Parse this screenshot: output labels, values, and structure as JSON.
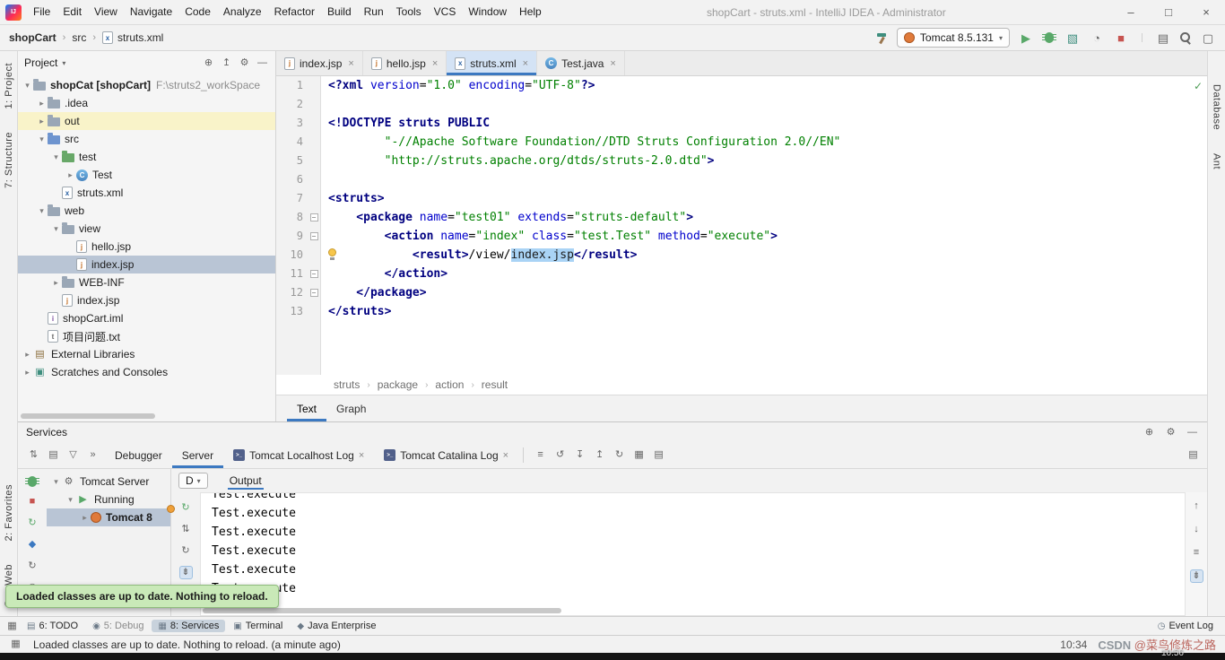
{
  "icons": {
    "minimize": "–",
    "maximize": "□",
    "close": "×",
    "chevron": "›",
    "dropdown": "▾",
    "expanded": "▾",
    "collapsed": "▸",
    "fold": "−",
    "locate": "⊕",
    "collapse_all": "↥",
    "settings": "⚙",
    "hide": "—",
    "menu": "▤",
    "soft_wrap": "≡",
    "rollback": "↺",
    "download": "↧",
    "upload": "↥",
    "refresh": "↻",
    "up": "↑",
    "down": "↓",
    "scroll_end": "⇟",
    "check": "✓",
    "event_log": "◷",
    "run": "▶",
    "stop": "■",
    "deploy": "◆",
    "restart": "↻",
    "browser": "◉",
    "sort": "⇅",
    "view_mode": "▤",
    "filter": "▽",
    "more": "»",
    "grid": "▦",
    "server": "⚙",
    "coverage": "▧",
    "profiler": "◔",
    "box": "▢",
    "lib": "▤",
    "scratch": "▣",
    "class_letter": "C",
    "console_glyph": ">_",
    "file_letters": {
      "jsp": "j",
      "xml": "x",
      "iml": "i",
      "txt": "t"
    }
  },
  "titlebar": {
    "menus": [
      "File",
      "Edit",
      "View",
      "Navigate",
      "Code",
      "Analyze",
      "Refactor",
      "Build",
      "Run",
      "Tools",
      "VCS",
      "Window",
      "Help"
    ],
    "title": "shopCart - struts.xml - IntelliJ IDEA - Administrator"
  },
  "navbar": {
    "path": [
      "shopCart",
      "src",
      "struts.xml"
    ],
    "run_config": "Tomcat 8.5.131"
  },
  "tool_strips": {
    "left_top": [
      "1: Project",
      "7: Structure"
    ],
    "left_bottom": [
      "2: Favorites",
      "Web"
    ],
    "right": [
      "Database",
      "Ant"
    ]
  },
  "project": {
    "title": "Project",
    "tree": [
      {
        "label": "shopCat [shopCart]",
        "hint": "F:\\struts2_workSpace",
        "icon": "folder",
        "level": 0,
        "arrow": "down",
        "bold": true
      },
      {
        "label": ".idea",
        "icon": "folder",
        "level": 1,
        "arrow": "right"
      },
      {
        "label": "out",
        "icon": "folder",
        "level": 1,
        "arrow": "right",
        "highlight": true
      },
      {
        "label": "src",
        "icon": "folder-src",
        "level": 1,
        "arrow": "down"
      },
      {
        "label": "test",
        "icon": "folder-test",
        "level": 2,
        "arrow": "down"
      },
      {
        "label": "Test",
        "icon": "class",
        "level": 3,
        "arrow": "right"
      },
      {
        "label": "struts.xml",
        "icon": "xml",
        "level": 2
      },
      {
        "label": "web",
        "icon": "folder-web",
        "level": 1,
        "arrow": "down"
      },
      {
        "label": "view",
        "icon": "folder",
        "level": 2,
        "arrow": "down"
      },
      {
        "label": "hello.jsp",
        "icon": "jsp",
        "level": 3
      },
      {
        "label": "index.jsp",
        "icon": "jsp",
        "level": 3,
        "selected": true
      },
      {
        "label": "WEB-INF",
        "icon": "folder",
        "level": 2,
        "arrow": "right"
      },
      {
        "label": "index.jsp",
        "icon": "jsp",
        "level": 2
      },
      {
        "label": "shopCart.iml",
        "icon": "iml",
        "level": 1
      },
      {
        "label": "项目问题.txt",
        "icon": "txt",
        "level": 1
      },
      {
        "label": "External Libraries",
        "icon": "lib",
        "level": 0,
        "arrow": "right"
      },
      {
        "label": "Scratches and Consoles",
        "icon": "scratch",
        "level": 0,
        "arrow": "right"
      }
    ]
  },
  "editor": {
    "tabs": [
      {
        "label": "index.jsp",
        "icon": "jsp"
      },
      {
        "label": "hello.jsp",
        "icon": "jsp"
      },
      {
        "label": "struts.xml",
        "icon": "xml",
        "active": true
      },
      {
        "label": "Test.java",
        "icon": "class"
      }
    ],
    "lines": [
      {
        "n": 1,
        "tokens": [
          [
            "tg",
            "<?xml "
          ],
          [
            "at",
            "version"
          ],
          [
            "tx",
            "="
          ],
          [
            "st",
            "\"1.0\""
          ],
          [
            "tx",
            " "
          ],
          [
            "at",
            "encoding"
          ],
          [
            "tx",
            "="
          ],
          [
            "st",
            "\"UTF-8\""
          ],
          [
            "tg",
            "?>"
          ]
        ]
      },
      {
        "n": 2,
        "tokens": []
      },
      {
        "n": 3,
        "tokens": [
          [
            "tg",
            "<!DOCTYPE "
          ],
          [
            "tgb",
            "struts "
          ],
          [
            "tg",
            "PUBLIC"
          ]
        ]
      },
      {
        "n": 4,
        "tokens": [
          [
            "st",
            "        \"-//Apache Software Foundation//DTD Struts Configuration 2.0//EN\""
          ]
        ]
      },
      {
        "n": 5,
        "tokens": [
          [
            "st",
            "        \"http://struts.apache.org/dtds/struts-2.0.dtd\""
          ],
          [
            "tg",
            ">"
          ]
        ]
      },
      {
        "n": 6,
        "tokens": []
      },
      {
        "n": 7,
        "tokens": [
          [
            "tg",
            "<struts>"
          ]
        ]
      },
      {
        "n": 8,
        "fold": true,
        "tokens": [
          [
            "tg",
            "    <package "
          ],
          [
            "at",
            "name"
          ],
          [
            "tx",
            "="
          ],
          [
            "st",
            "\"test01\""
          ],
          [
            "tx",
            " "
          ],
          [
            "at",
            "extends"
          ],
          [
            "tx",
            "="
          ],
          [
            "st",
            "\"struts-default\""
          ],
          [
            "tg",
            ">"
          ]
        ]
      },
      {
        "n": 9,
        "fold": true,
        "tokens": [
          [
            "tg",
            "        <action "
          ],
          [
            "at",
            "name"
          ],
          [
            "tx",
            "="
          ],
          [
            "st",
            "\"index\""
          ],
          [
            "tx",
            " "
          ],
          [
            "at",
            "class"
          ],
          [
            "tx",
            "="
          ],
          [
            "st",
            "\"test.Test\""
          ],
          [
            "tx",
            " "
          ],
          [
            "at",
            "method"
          ],
          [
            "tx",
            "="
          ],
          [
            "st",
            "\"execute\""
          ],
          [
            "tg",
            ">"
          ]
        ]
      },
      {
        "n": 10,
        "bulb": true,
        "tokens": [
          [
            "tg",
            "            <result>"
          ],
          [
            "tx",
            "/view/"
          ],
          [
            "hl",
            "index.jsp"
          ],
          [
            "tg",
            "</result>"
          ]
        ]
      },
      {
        "n": 11,
        "fold": true,
        "tokens": [
          [
            "tg",
            "        </action>"
          ]
        ]
      },
      {
        "n": 12,
        "fold": true,
        "tokens": [
          [
            "tg",
            "    </package>"
          ]
        ]
      },
      {
        "n": 13,
        "tokens": [
          [
            "tg",
            "</struts>"
          ]
        ]
      }
    ],
    "breadcrumbs": [
      "struts",
      "package",
      "action",
      "result"
    ],
    "view_tabs": [
      "Text",
      "Graph"
    ],
    "active_view_tab": "Text"
  },
  "services": {
    "title": "Services",
    "tabs": [
      {
        "label": "Debugger"
      },
      {
        "label": "Server",
        "active": true
      },
      {
        "label": "Tomcat Localhost Log",
        "icon": "console",
        "close": true
      },
      {
        "label": "Tomcat Catalina Log",
        "icon": "console",
        "close": true
      }
    ],
    "tree": [
      {
        "label": "Tomcat Server",
        "icon": "server",
        "level": 0,
        "arrow": "down"
      },
      {
        "label": "Running",
        "icon": "run",
        "level": 1,
        "arrow": "down"
      },
      {
        "label": "Tomcat 8",
        "icon": "tomcat",
        "level": 2,
        "arrow": "right",
        "selected": true,
        "bold": true
      }
    ],
    "deploy_button": "D",
    "output_tab": "Output",
    "output_lines": [
      "Test.execute",
      "Test.execute",
      "Test.execute",
      "Test.execute",
      "Test.execute",
      "Test.execute"
    ],
    "tooltip": "Loaded classes are up to date. Nothing to reload."
  },
  "toolwindow_bar": {
    "items": [
      {
        "label": "6: TODO",
        "glyph": "▤"
      },
      {
        "label": "5: Debug",
        "glyph": "◉",
        "muted": true
      },
      {
        "label": "8: Services",
        "glyph": "▦",
        "active": true
      },
      {
        "label": "Terminal",
        "glyph": "▣"
      },
      {
        "label": "Java Enterprise",
        "glyph": "◆"
      }
    ],
    "event_log": "Event Log"
  },
  "statusbar": {
    "message": "Loaded classes are up to date. Nothing to reload. (a minute ago)",
    "caret": "10:34",
    "watermark_brand": "CSDN",
    "watermark_user": "@菜鸟修炼之路",
    "video_time": "10:56"
  }
}
